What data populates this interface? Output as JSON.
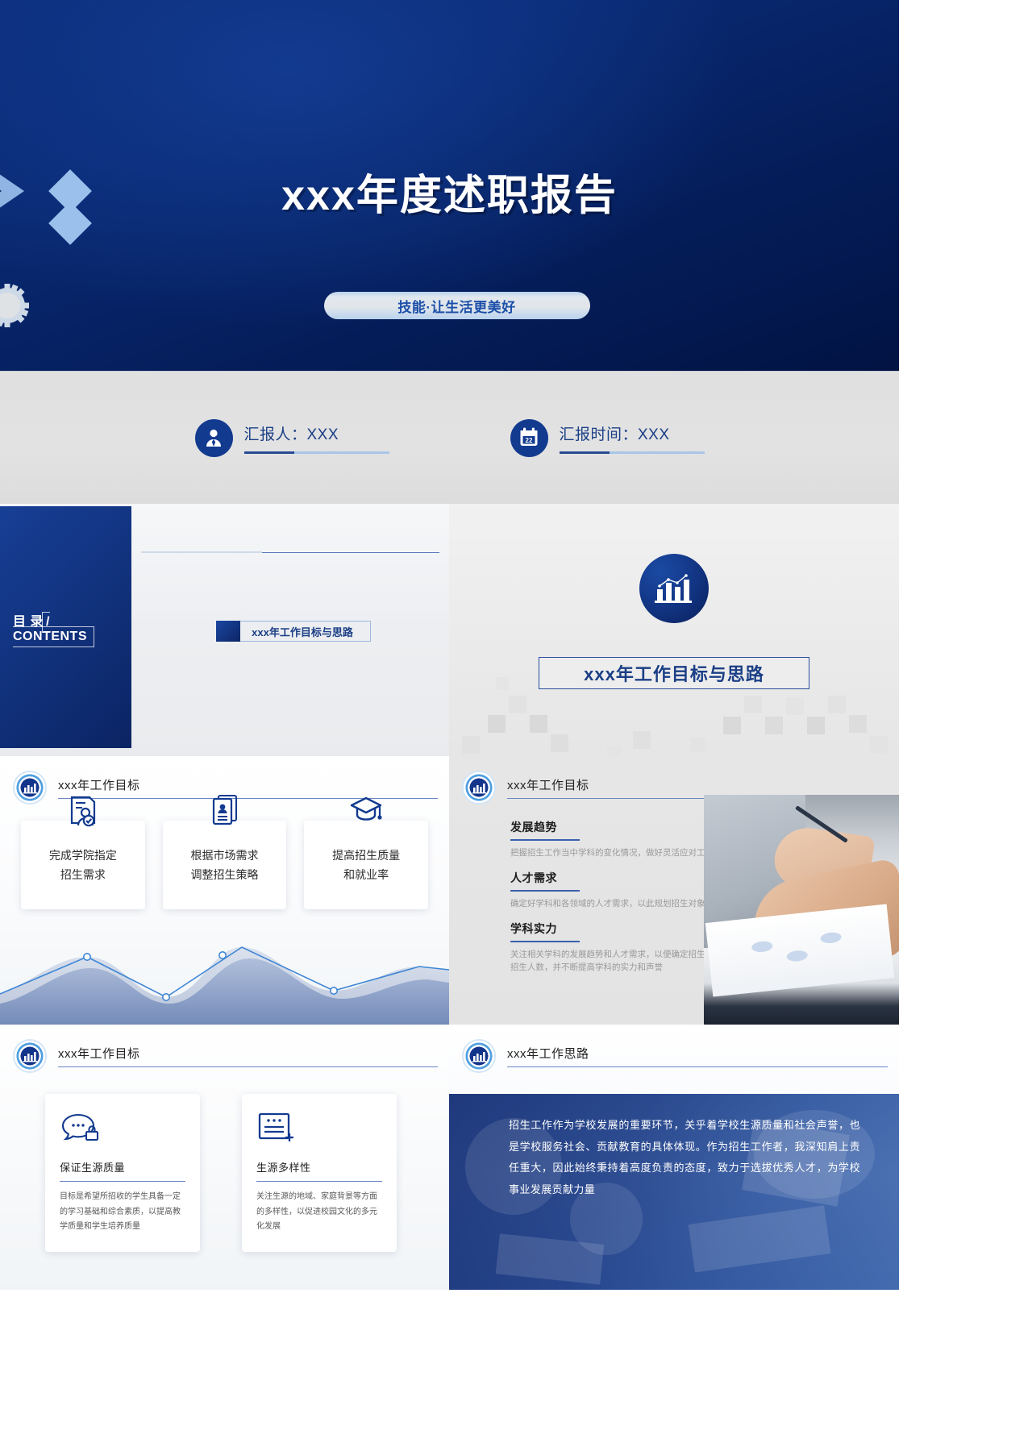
{
  "cover": {
    "title": "xxx年度述职报告",
    "badge": "技能·让生活更美好",
    "gear_icon": "gear-icon",
    "chevron_icon": "chevron-right-icon",
    "diamond_icon": "diamond-icon",
    "bg_color": "#0a2a74",
    "accent_color": "#9cc0ec"
  },
  "meta": {
    "presenter": {
      "icon": "person-icon",
      "text": "汇报人：XXX"
    },
    "date": {
      "icon": "calendar-icon",
      "day": "22",
      "text": "汇报时间：XXX"
    }
  },
  "contents": {
    "toc_label_cn": "目 录",
    "toc_label_en": "/ CONTENTS",
    "entry": "xxx年工作目标与思路",
    "section_icon": "bar-chart-icon",
    "section_title": "xxx年工作目标与思路"
  },
  "goals": {
    "header": "xxx年工作目标",
    "header_icon": "bar-chart-ring-icon",
    "cards": [
      {
        "icon": "id-card-person-icon",
        "line1": "完成学院指定",
        "line2": "招生需求"
      },
      {
        "icon": "badge-card-icon",
        "line1": "根据市场需求",
        "line2": "调整招生策略"
      },
      {
        "icon": "graduation-cap-icon",
        "line1": "提高招生质量",
        "line2": "和就业率"
      }
    ]
  },
  "trends": {
    "header": "xxx年工作目标",
    "header_icon": "bar-chart-ring-icon",
    "items": [
      {
        "title": "发展趋势",
        "desc": "把握招生工作当中学科的变化情况，做好灵活应对工作"
      },
      {
        "title": "人才需求",
        "desc": "确定好学科和各领域的人才需求，以此规划招生对象和人数"
      },
      {
        "title": "学科实力",
        "desc": "关注相关学科的发展趋势和人才需求，以便确定招生学科和招生人数，并不断提高学科的实力和声誉"
      }
    ],
    "photo_alt": "meeting-photo"
  },
  "quality": {
    "header": "xxx年工作目标",
    "header_icon": "bar-chart-ring-icon",
    "cards": [
      {
        "icon": "chat-lock-icon",
        "title": "保证生源质量",
        "desc": "目标是希望所招收的学生具备一定的学习基础和综合素质，以提高教学质量和学生培养质量"
      },
      {
        "icon": "add-note-icon",
        "title": "生源多样性",
        "desc": "关注生源的地域、家庭背景等方面的多样性，以促进校园文化的多元化发展"
      }
    ]
  },
  "ideas": {
    "header": "xxx年工作思路",
    "header_icon": "bar-chart-ring-icon",
    "paragraph": "招生工作作为学校发展的重要环节，关乎着学校生源质量和社会声誉，也是学校服务社会、贡献教育的具体体现。作为招生工作者，我深知肩上责任重大，因此始终秉持着高度负责的态度，致力于选拔优秀人才，为学校事业发展贡献力量"
  },
  "theme": {
    "primary": "#123a8f",
    "deep": "#0a2a74",
    "light_blue": "#9cc0ec",
    "text_blue": "#1b3f86",
    "grey_bg": "#e2e2e2"
  }
}
